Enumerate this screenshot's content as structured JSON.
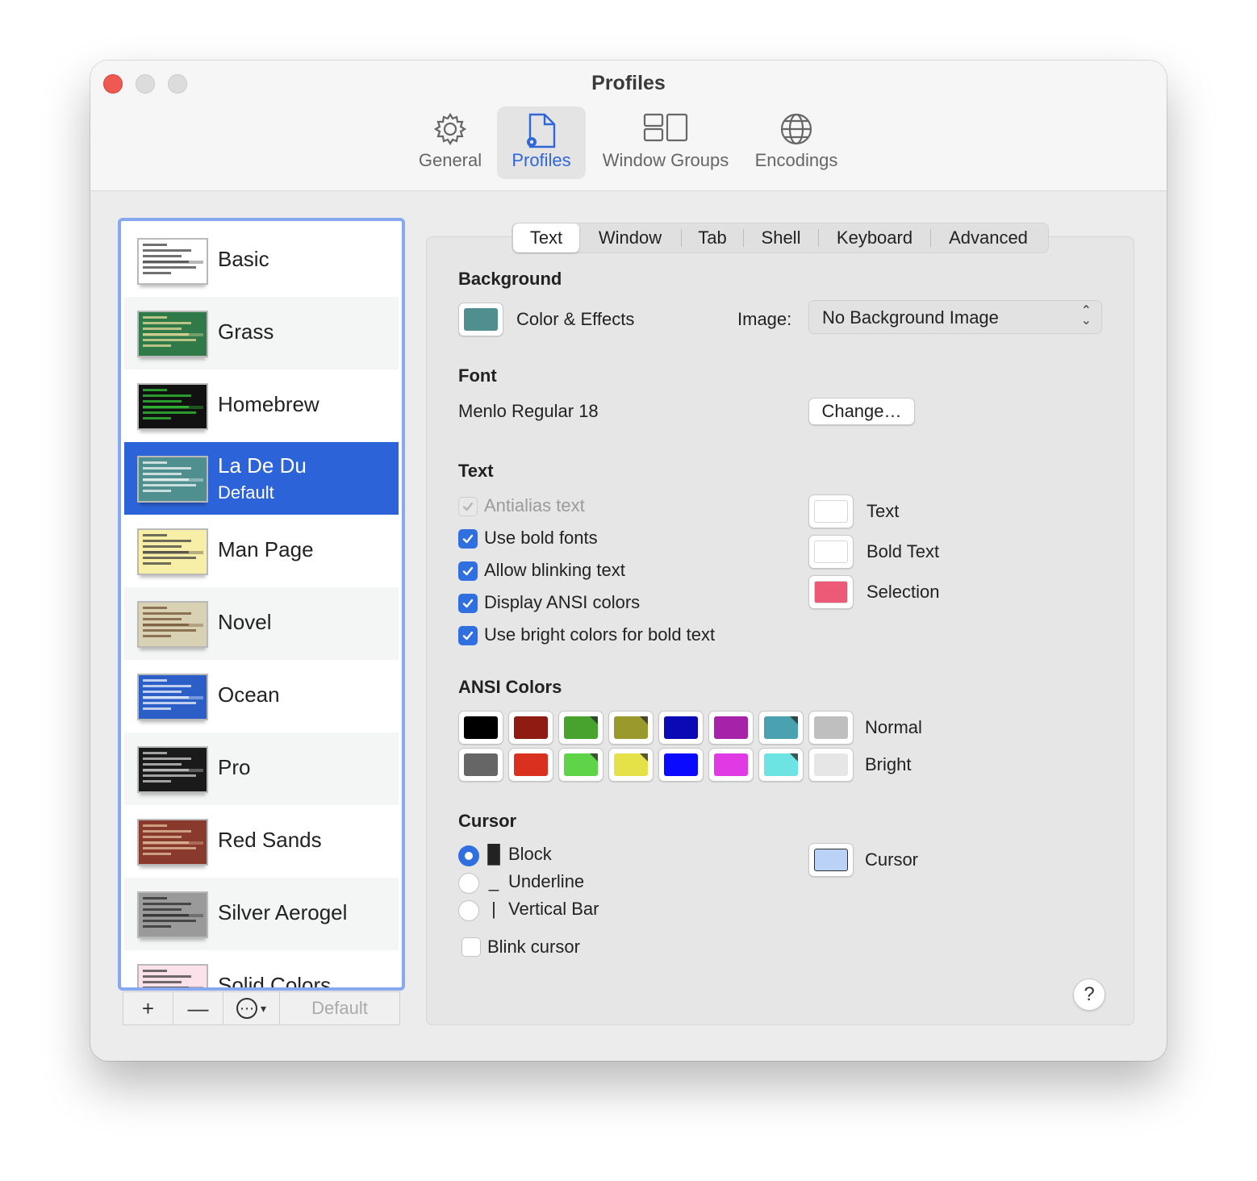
{
  "window": {
    "title": "Profiles"
  },
  "toolbar": [
    {
      "label": "General",
      "icon": "gear-icon"
    },
    {
      "label": "Profiles",
      "icon": "profiles-icon"
    },
    {
      "label": "Window Groups",
      "icon": "window-groups-icon"
    },
    {
      "label": "Encodings",
      "icon": "globe-icon"
    }
  ],
  "profiles": [
    {
      "name": "Basic",
      "bg": "#ffffff",
      "fg": "#333333"
    },
    {
      "name": "Grass",
      "bg": "#2f7a48",
      "fg": "#f4e3a0"
    },
    {
      "name": "Homebrew",
      "bg": "#111111",
      "fg": "#36d43a"
    },
    {
      "name": "La De Du",
      "sub": "Default",
      "bg": "#4f8f8f",
      "fg": "#ffffff",
      "selected": true
    },
    {
      "name": "Man Page",
      "bg": "#f7efa8",
      "fg": "#333333"
    },
    {
      "name": "Novel",
      "bg": "#d9d1b3",
      "fg": "#6b4a2a"
    },
    {
      "name": "Ocean",
      "bg": "#2c5ec8",
      "fg": "#ffffff"
    },
    {
      "name": "Pro",
      "bg": "#1a1a1a",
      "fg": "#dddddd"
    },
    {
      "name": "Red Sands",
      "bg": "#8a3a2c",
      "fg": "#e8c9a6"
    },
    {
      "name": "Silver Aerogel",
      "bg": "#9a9a9a",
      "fg": "#222222"
    },
    {
      "name": "Solid Colors",
      "bg": "#fbe2ea",
      "fg": "#333333"
    }
  ],
  "list_footer": {
    "add": "+",
    "remove": "—",
    "more": "⋯",
    "default_label": "Default"
  },
  "tabs": [
    "Text",
    "Window",
    "Tab",
    "Shell",
    "Keyboard",
    "Advanced"
  ],
  "background": {
    "title": "Background",
    "color_label": "Color & Effects",
    "color": "#4f8f8f",
    "image_label": "Image:",
    "image_value": "No Background Image"
  },
  "font": {
    "title": "Font",
    "value": "Menlo Regular 18",
    "change_button": "Change…"
  },
  "text": {
    "title": "Text",
    "options": [
      {
        "label": "Antialias text",
        "checked": true,
        "disabled": true
      },
      {
        "label": "Use bold fonts",
        "checked": true
      },
      {
        "label": "Allow blinking text",
        "checked": true
      },
      {
        "label": "Display ANSI colors",
        "checked": true
      },
      {
        "label": "Use bright colors for bold text",
        "checked": true
      }
    ],
    "colors": [
      {
        "label": "Text",
        "color": "#ffffff"
      },
      {
        "label": "Bold Text",
        "color": "#ffffff"
      },
      {
        "label": "Selection",
        "color": "#ec5a78"
      }
    ]
  },
  "ansi": {
    "title": "ANSI Colors",
    "normal_label": "Normal",
    "bright_label": "Bright",
    "normal": [
      "#000000",
      "#8e1c12",
      "#48a22e",
      "#9a9a2c",
      "#0a0ab4",
      "#a622a9",
      "#4aa2b0",
      "#bfbfbf"
    ],
    "bright": [
      "#666666",
      "#d9301f",
      "#5fd449",
      "#e4e248",
      "#0a0aff",
      "#e03ae4",
      "#6de3e4",
      "#e6e6e6"
    ]
  },
  "cursor": {
    "title": "Cursor",
    "options": [
      {
        "glyph": "█",
        "label": "Block",
        "selected": true
      },
      {
        "glyph": "_",
        "label": "Underline"
      },
      {
        "glyph": "|",
        "label": "Vertical Bar"
      }
    ],
    "blink_label": "Blink cursor",
    "color_label": "Cursor",
    "color": "#b9d2f5"
  },
  "help": "?"
}
